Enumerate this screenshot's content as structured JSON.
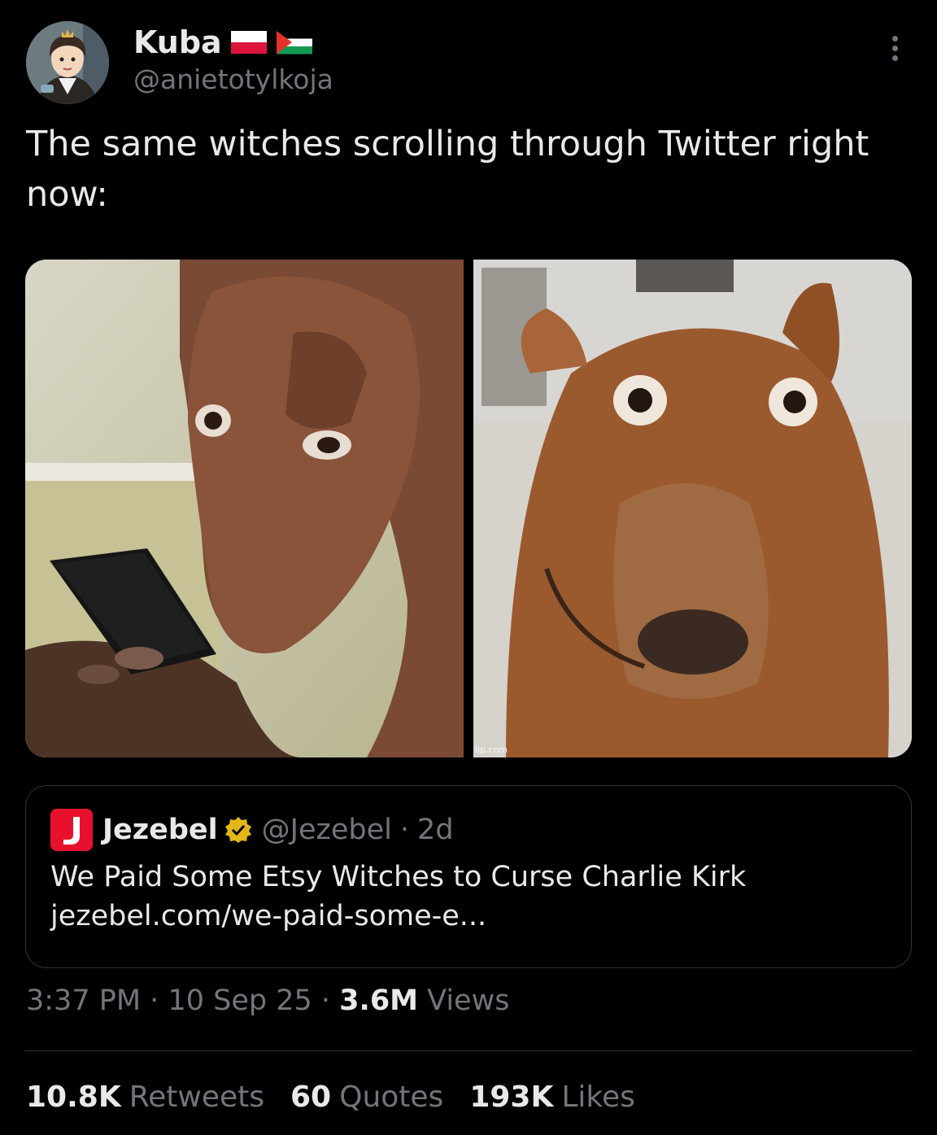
{
  "author": {
    "display_name": "Kuba",
    "handle": "@anietotylkoja",
    "flags": [
      "poland-flag",
      "palestine-flag"
    ],
    "avatar_icon": "cartoon-avatar"
  },
  "tweet": {
    "text": "The same witches scrolling through Twitter right now:"
  },
  "media": {
    "images": [
      {
        "icon": "dog-looking-at-phone-image"
      },
      {
        "icon": "shocked-dog-image"
      }
    ],
    "watermark": "lip.com"
  },
  "quote": {
    "logo_letter": "J",
    "name": "Jezebel",
    "handle": "@Jezebel",
    "separator": "·",
    "time": "2d",
    "title": "We Paid Some Etsy Witches to Curse Charlie Kirk",
    "link": "jezebel.com/we-paid-some-e..."
  },
  "meta": {
    "time": "3:37 PM",
    "date": "10 Sep 25",
    "views_count": "3.6M",
    "views_label": "Views",
    "separator": "·"
  },
  "stats": {
    "retweets_count": "10.8K",
    "retweets_label": "Retweets",
    "quotes_count": "60",
    "quotes_label": "Quotes",
    "likes_count": "193K",
    "likes_label": "Likes"
  },
  "colors": {
    "background": "#000000",
    "text": "#e7e9ea",
    "secondary": "#71767b",
    "border": "#2f3336",
    "jezebel_red": "#e8112d",
    "verified_gold": "#e2b719"
  }
}
